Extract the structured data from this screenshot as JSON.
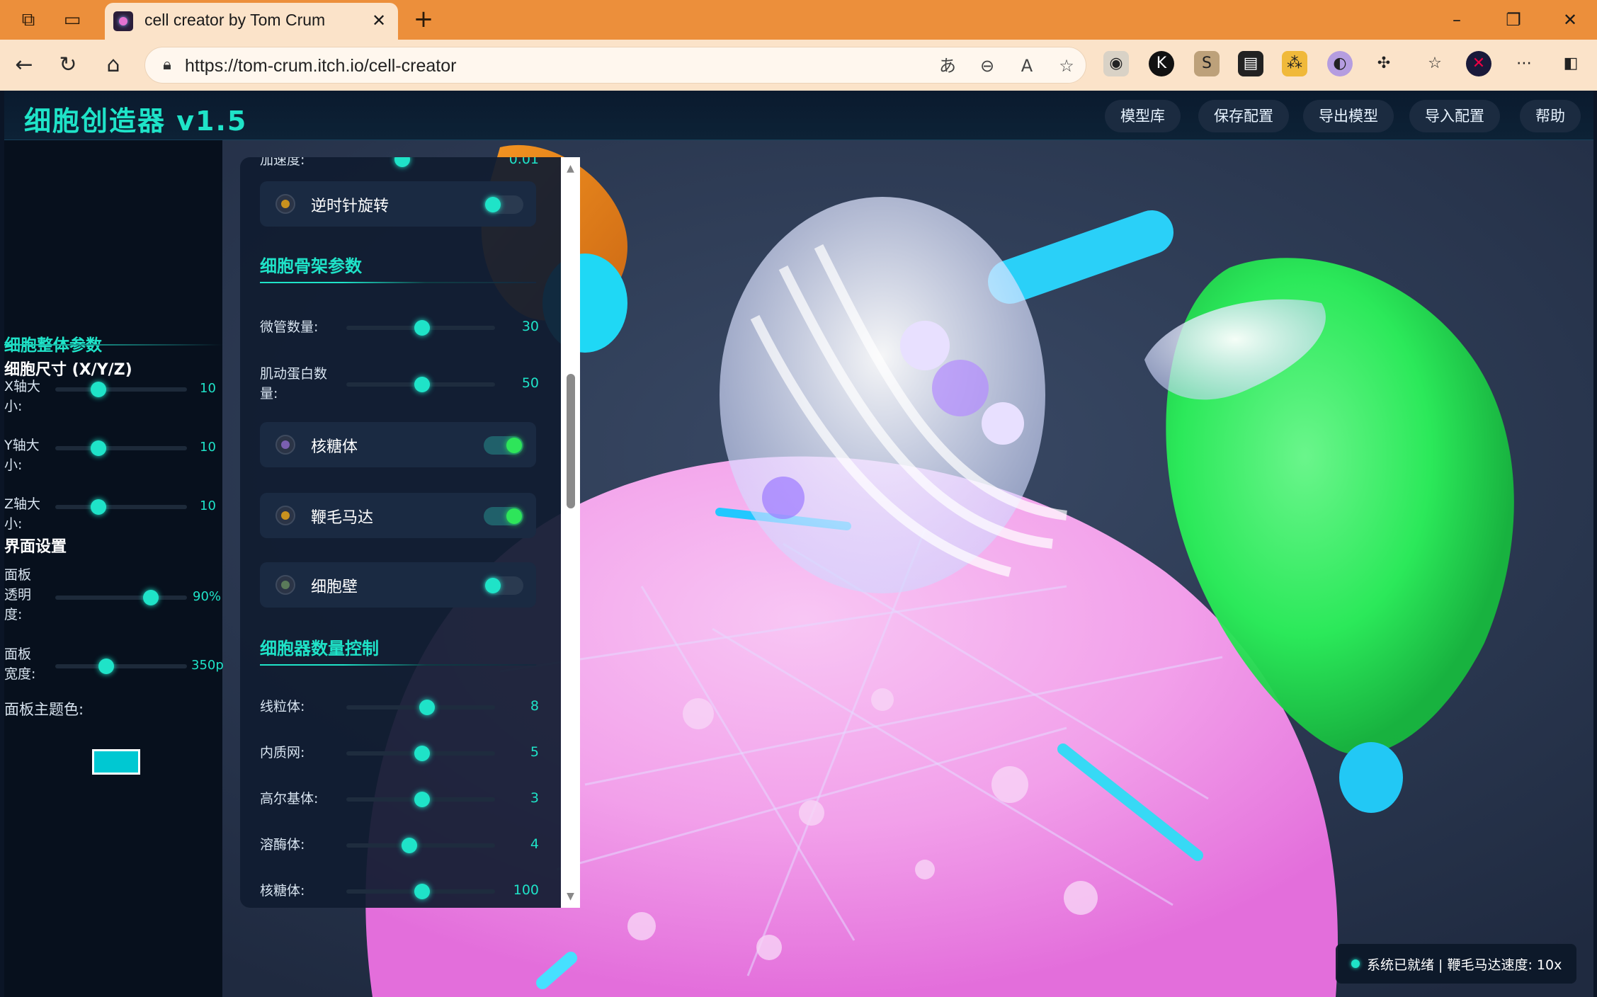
{
  "browser": {
    "tab_title": "cell creator by Tom Crum",
    "url": "https://tom-crum.itch.io/cell-creator",
    "chrome_color": "#ec8f3b"
  },
  "app": {
    "title": "细胞创造器 v1.5",
    "accent_color": "#1fe3c8",
    "nav": [
      "模型库",
      "保存配置",
      "导出模型",
      "导入配置",
      "帮助"
    ]
  },
  "left_panel": {
    "section_cell": "细胞整体参数",
    "size_group": "细胞尺寸 (X/Y/Z)",
    "x_label": "X轴大小:",
    "x_value": "10",
    "y_label": "Y轴大小:",
    "y_value": "10",
    "z_label": "Z轴大小:",
    "z_value": "10",
    "section_ui": "界面设置",
    "opacity_label": "面板透明度:",
    "opacity_value": "90%",
    "width_label": "面板宽度:",
    "width_value": "350p",
    "theme_label": "面板主题色:",
    "theme_color": "#00c8d2"
  },
  "float_panel": {
    "accel_label": "加速度:",
    "accel_value": "0.01",
    "ccw_label": "逆时针旋转",
    "ccw_on": false,
    "cyto_section": "细胞骨架参数",
    "microtubule_label": "微管数量:",
    "microtubule_value": "30",
    "actin_label": "肌动蛋白数量:",
    "actin_value": "50",
    "ribosome_toggle_label": "核糖体",
    "ribosome_on": true,
    "flagellum_label": "鞭毛马达",
    "flagellum_on": true,
    "cellwall_label": "细胞壁",
    "cellwall_on": false,
    "organelle_section": "细胞器数量控制",
    "mito_label": "线粒体:",
    "mito_value": "8",
    "er_label": "内质网:",
    "er_value": "5",
    "golgi_label": "高尔基体:",
    "golgi_value": "3",
    "lyso_label": "溶酶体:",
    "lyso_value": "4",
    "ribo_label": "核糖体:",
    "ribo_value": "100"
  },
  "status": {
    "text": "系统已就绪 | 鞭毛马达速度: 10x"
  }
}
